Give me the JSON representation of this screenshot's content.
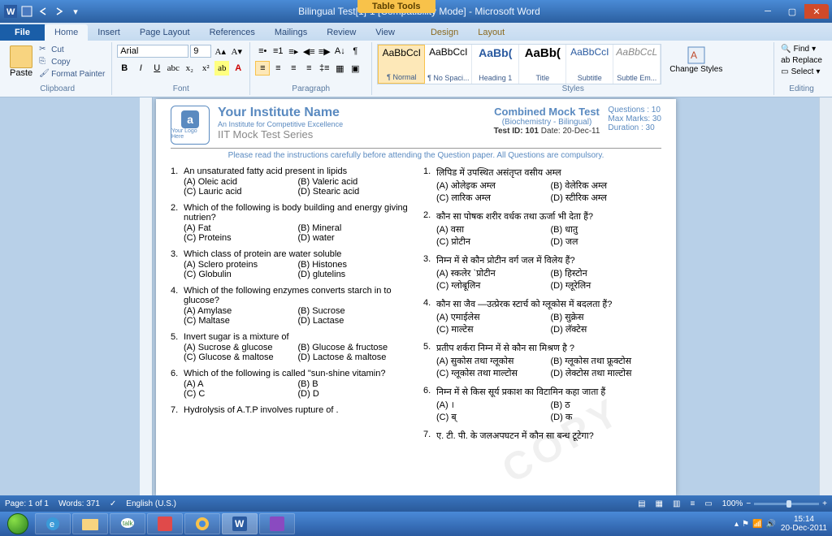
{
  "window": {
    "title": "Bilingual Test[1]-1 [Compatibility Mode] - Microsoft Word",
    "table_tools": "Table Tools"
  },
  "tabs": {
    "file": "File",
    "home": "Home",
    "insert": "Insert",
    "pagelayout": "Page Layout",
    "references": "References",
    "mailings": "Mailings",
    "review": "Review",
    "view": "View",
    "design": "Design",
    "layout": "Layout"
  },
  "ribbon": {
    "clipboard": {
      "label": "Clipboard",
      "paste": "Paste",
      "cut": "Cut",
      "copy": "Copy",
      "format_painter": "Format Painter"
    },
    "font": {
      "label": "Font",
      "name": "Arial",
      "size": "9"
    },
    "paragraph": {
      "label": "Paragraph"
    },
    "styles": {
      "label": "Styles",
      "change": "Change Styles",
      "items": [
        {
          "preview": "AaBbCcI",
          "name": "¶ Normal"
        },
        {
          "preview": "AaBbCcI",
          "name": "¶ No Spaci..."
        },
        {
          "preview": "AaBb(",
          "name": "Heading 1"
        },
        {
          "preview": "AaBb(",
          "name": "Title"
        },
        {
          "preview": "AaBbCcI",
          "name": "Subtitle"
        },
        {
          "preview": "AaBbCcL",
          "name": "Subtle Em..."
        }
      ]
    },
    "editing": {
      "label": "Editing",
      "find": "Find",
      "replace": "Replace",
      "select": "Select"
    }
  },
  "doc": {
    "logo_text": "Your Logo Here",
    "inst_name": "Your Institute Name",
    "inst_tag": "An Institute for Competitive Excellence",
    "inst_series": "IIT Mock Test Series",
    "test_title": "Combined Mock Test",
    "test_sub": "(Biochemistry  - Bilingual)",
    "test_id_label": "Test ID:",
    "test_id": "101",
    "date_label": "Date:",
    "date": "20-Dec-11",
    "meta_q": "Questions  :  10",
    "meta_m": "Max Marks: 30",
    "meta_d": "Duration    : 30",
    "instructions": "Please read the instructions carefully before attending the Question paper. All Questions are compulsory.",
    "questions_en": [
      {
        "n": "1.",
        "q": "An unsaturated  fatty acid present in lipids",
        "a": "(A) Oleic acid",
        "b": "(B) Valeric acid",
        "c": "(C) Lauric acid",
        "d": "(D) Stearic acid"
      },
      {
        "n": "2.",
        "q": "Which of the following is body building and energy giving nutrien?",
        "a": "(A) Fat",
        "b": "(B) Mineral",
        "c": "(C) Proteins",
        "d": "(D) water"
      },
      {
        "n": "3.",
        "q": "Which class of protein are water soluble",
        "a": "(A) Sclero proteins",
        "b": "(B) Histones",
        "c": "(C) Globulin",
        "d": "(D) glutelins"
      },
      {
        "n": "4.",
        "q": "Which of the following enzymes converts starch in to glucose?",
        "a": "(A) Amylase",
        "b": "(B) Sucrose",
        "c": "(C) Maltase",
        "d": "(D) Lactase"
      },
      {
        "n": "5.",
        "q": "Invert sugar is a mixture of",
        "a": "(A) Sucrose & glucose",
        "b": "(B) Glucose & fructose",
        "c": "(C) Glucose & maltose",
        "d": "(D) Lactose & maltose"
      },
      {
        "n": "6.",
        "q": "Which of the following is called \"sun-shine vitamin?",
        "a": "(A) A",
        "b": "(B) B",
        "c": "(C) C",
        "d": "(D) D"
      },
      {
        "n": "7.",
        "q": "Hydrolysis of A.T.P involves  rupture of ."
      }
    ],
    "questions_hi": [
      {
        "n": "1.",
        "q": "लिपिड में उपस्थित असंतृप्त वसीय अम्ल",
        "a": "(A) ओलेइक  अम्ल",
        "b": "(B) वेलेरिक अम्ल",
        "c": "(C) लारिक अम्ल",
        "d": "(D) स्टीरिक अम्ल"
      },
      {
        "n": "2.",
        "q": "कौन सा  पोषक   शरीर वर्धक तथा ऊर्जा भी देता हैं?",
        "a": "(A) वसा",
        "b": "(B) धातु",
        "c": "(C) प्रोटीन",
        "d": "(D) जल"
      },
      {
        "n": "3.",
        "q": "निम्न में से कौन प्रोटीन वर्ग जल में विलेय हैं?",
        "a": "(A) स्कलेर `प्रोटीन",
        "b": "(B) हिस्टोन",
        "c": "(C) ग्लोबूलिन",
        "d": "(D) ग्लूरेलिन"
      },
      {
        "n": "4.",
        "q": "कौन सा जैव —उत्प्रेरक  स्टार्च को ग्लूकोस में बदलता हैं?",
        "a": "(A) एमाईलेस",
        "b": "(B) सुक्रेस",
        "c": "(C) माल्टेस",
        "d": "(D) लॅक्टेस"
      },
      {
        "n": "5.",
        "q": "प्रतीप शर्करा निम्न में से कौन सा मिश्रण है ?",
        "a": "(A)  सुकोस तथा ग्लूकोस",
        "b": "(B)   ग्लूकोस तथा फ्रूक्टोस",
        "c": "(C) ग्लूकोस तथा माल्टोस",
        "d": "(D)  लेक्टोस तथा माल्टोस"
      },
      {
        "n": "6.",
        "q": "निम्न में से किस सूर्य प्रकाश का विटामिन कहा जाता हैं",
        "a": "(A) ।",
        "b": "(B) ठ",
        "c": "(C) ब्",
        "d": "(D) क"
      },
      {
        "n": "7.",
        "q": "ए. टी. पी. के जलअपघटन में कौन सा बन्ध टूटेगा?"
      }
    ]
  },
  "status": {
    "page": "Page: 1 of 1",
    "words": "Words: 371",
    "lang": "English (U.S.)",
    "zoom": "100%"
  },
  "taskbar": {
    "time": "15:14",
    "date": "20-Dec-2011"
  }
}
